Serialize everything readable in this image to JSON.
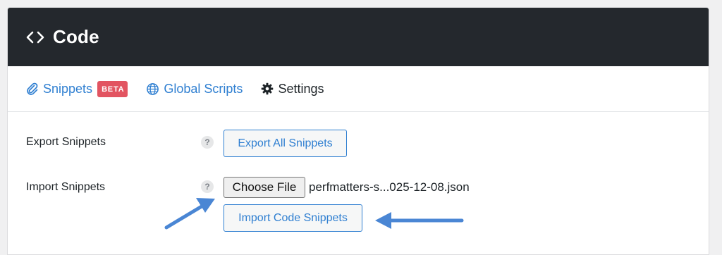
{
  "header": {
    "icon": "code-brackets-icon",
    "title": "Code"
  },
  "tabs": [
    {
      "label": "Snippets",
      "icon": "paperclip-icon",
      "badge": "BETA"
    },
    {
      "label": "Global Scripts",
      "icon": "globe-icon"
    },
    {
      "label": "Settings",
      "icon": "gear-icon"
    }
  ],
  "export": {
    "label": "Export Snippets",
    "help": "?",
    "button": "Export All Snippets"
  },
  "import": {
    "label": "Import Snippets",
    "help": "?",
    "choose_file": "Choose File",
    "file_name": "perfmatters-s...025-12-08.json",
    "button": "Import Code Snippets"
  },
  "colors": {
    "accent": "#2f7fd1",
    "header_bg": "#24282d",
    "badge": "#e25461",
    "annotation_arrow": "#4a86d4"
  }
}
